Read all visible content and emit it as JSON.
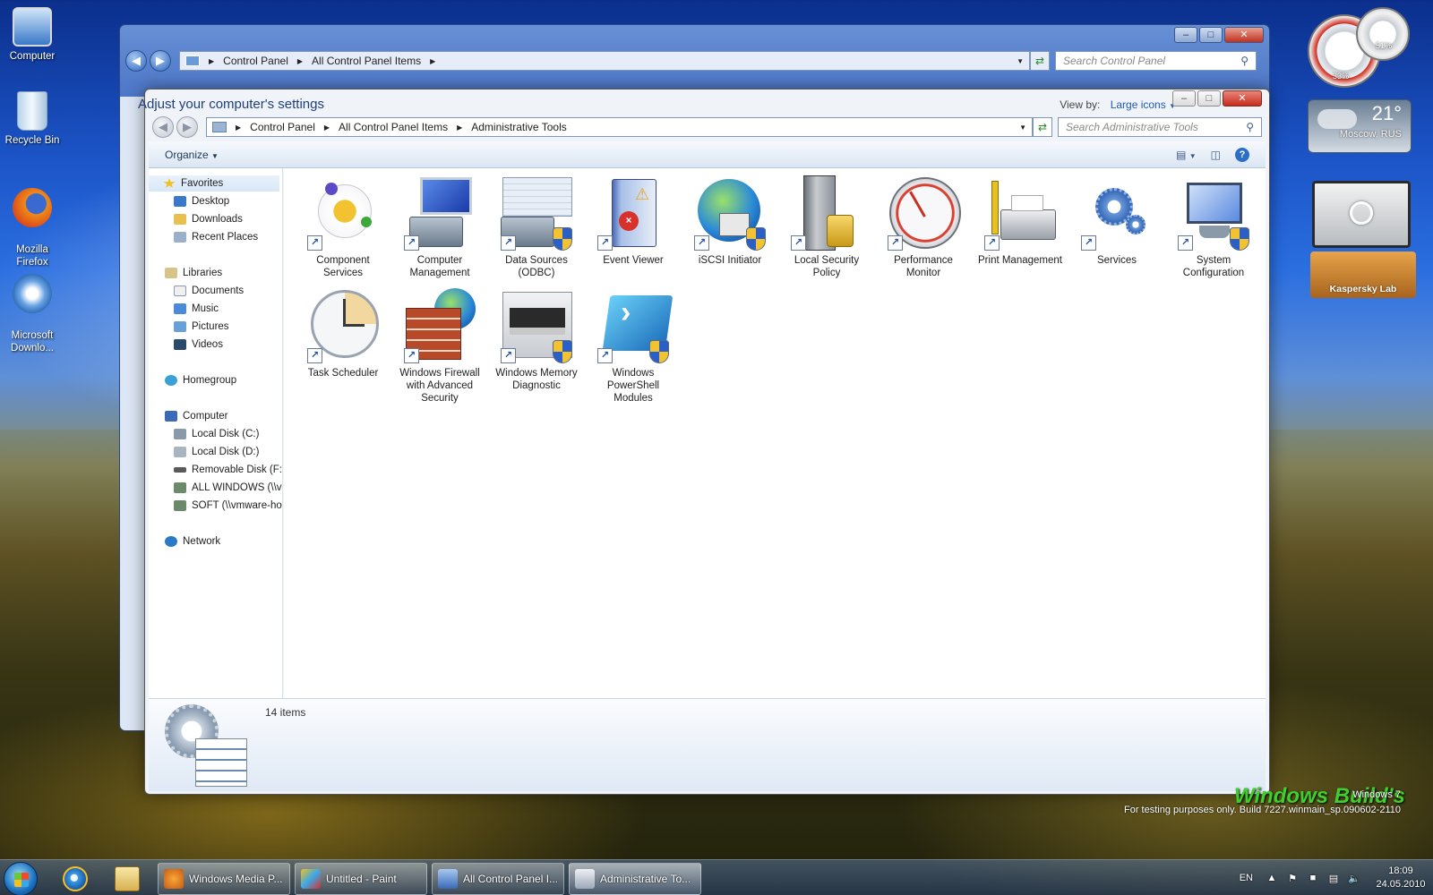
{
  "desktop": {
    "icons": [
      {
        "label": "Computer"
      },
      {
        "label": "Recycle Bin"
      },
      {
        "label": "Mozilla\nFirefox"
      },
      {
        "label": "Microsoft\nDownlo..."
      }
    ]
  },
  "back_window": {
    "address": [
      "Control Panel",
      "All Control Panel Items"
    ],
    "search_placeholder": "Search Control Panel",
    "heading": "Adjust your computer's settings",
    "view_by_label": "View by:",
    "view_by_value": "Large icons"
  },
  "front_window": {
    "address": [
      "Control Panel",
      "All Control Panel Items",
      "Administrative Tools"
    ],
    "search_placeholder": "Search Administrative Tools",
    "toolbar": {
      "organize": "Organize"
    },
    "nav": {
      "favorites": "Favorites",
      "desktop": "Desktop",
      "downloads": "Downloads",
      "recent_places": "Recent Places",
      "libraries": "Libraries",
      "documents": "Documents",
      "music": "Music",
      "pictures": "Pictures",
      "videos": "Videos",
      "homegroup": "Homegroup",
      "computer": "Computer",
      "local_c": "Local Disk (C:)",
      "local_d": "Local Disk (D:)",
      "removable_f": "Removable Disk (F:)",
      "all_windows": "ALL WINDOWS (\\\\vr",
      "soft": "SOFT (\\\\vmware-ho",
      "network": "Network"
    },
    "tools": [
      {
        "label": "Component Services",
        "icon": "component-services-icon"
      },
      {
        "label": "Computer Management",
        "icon": "computer-management-icon"
      },
      {
        "label": "Data Sources (ODBC)",
        "icon": "data-sources-icon"
      },
      {
        "label": "Event Viewer",
        "icon": "event-viewer-icon"
      },
      {
        "label": "iSCSI Initiator",
        "icon": "iscsi-initiator-icon"
      },
      {
        "label": "Local Security Policy",
        "icon": "local-security-policy-icon"
      },
      {
        "label": "Performance Monitor",
        "icon": "performance-monitor-icon"
      },
      {
        "label": "Print Management",
        "icon": "print-management-icon"
      },
      {
        "label": "Services",
        "icon": "services-icon"
      },
      {
        "label": "System Configuration",
        "icon": "system-configuration-icon"
      },
      {
        "label": "Task Scheduler",
        "icon": "task-scheduler-icon"
      },
      {
        "label": "Windows Firewall with Advanced Security",
        "icon": "windows-firewall-icon"
      },
      {
        "label": "Windows Memory Diagnostic",
        "icon": "memory-diagnostic-icon"
      },
      {
        "label": "Windows PowerShell Modules",
        "icon": "powershell-icon"
      }
    ],
    "details": {
      "count": "14 items"
    }
  },
  "gadgets": {
    "cpu_percent": "33%",
    "ram_percent": "51%",
    "weather_temp": "21°",
    "weather_city": "Moscow, RUS",
    "kaspersky": "Kaspersky Lab"
  },
  "watermark": {
    "line1": "Windows 7",
    "line2": "For testing purposes only. Build 7227.winmain_sp.090602-2110",
    "logo": "Windows Build's"
  },
  "taskbar": {
    "tasks": [
      {
        "label": "Windows Media P..."
      },
      {
        "label": "Untitled - Paint"
      },
      {
        "label": "All Control Panel I..."
      },
      {
        "label": "Administrative To..."
      }
    ],
    "language": "EN",
    "time": "18:09",
    "date": "24.05.2010"
  },
  "colors": {
    "accent": "#1d5ab4",
    "close_button": "#c82c1c",
    "desktop_sky": "#1c55c8"
  }
}
